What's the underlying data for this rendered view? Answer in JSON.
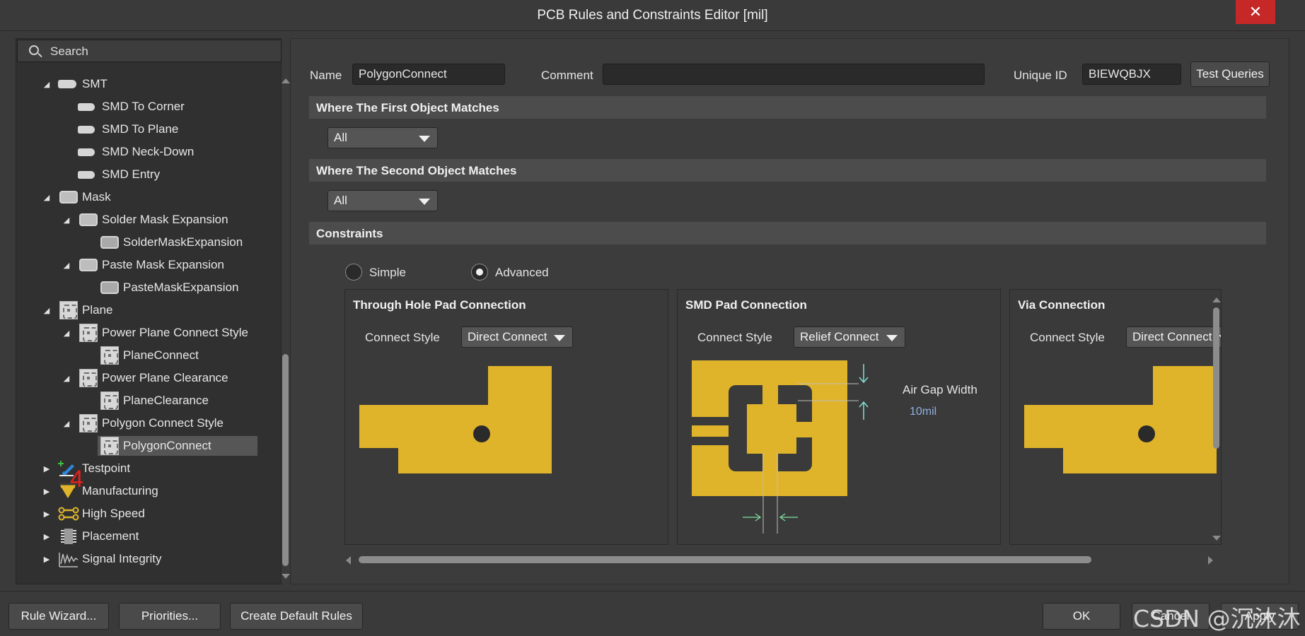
{
  "window": {
    "title": "PCB Rules and Constraints Editor [mil]"
  },
  "search": {
    "placeholder": "Search"
  },
  "tree": {
    "smt": "SMT",
    "smd_to_corner": "SMD To Corner",
    "smd_to_plane": "SMD To Plane",
    "smd_neck_down": "SMD Neck-Down",
    "smd_entry": "SMD Entry",
    "mask": "Mask",
    "solder_mask_expansion": "Solder Mask Expansion",
    "solder_mask_expansion_rule": "SolderMaskExpansion",
    "paste_mask_expansion": "Paste Mask Expansion",
    "paste_mask_expansion_rule": "PasteMaskExpansion",
    "plane": "Plane",
    "power_plane_connect_style": "Power Plane Connect Style",
    "plane_connect": "PlaneConnect",
    "power_plane_clearance": "Power Plane Clearance",
    "plane_clearance": "PlaneClearance",
    "polygon_connect_style": "Polygon Connect Style",
    "polygon_connect": "PolygonConnect",
    "testpoint": "Testpoint",
    "manufacturing": "Manufacturing",
    "high_speed": "High Speed",
    "placement": "Placement",
    "signal_integrity": "Signal Integrity"
  },
  "annotation": "4",
  "rule": {
    "name_label": "Name",
    "name": "PolygonConnect",
    "comment_label": "Comment",
    "comment": "",
    "unique_id_label": "Unique ID",
    "unique_id": "BIEWQBJX",
    "test_queries": "Test Queries"
  },
  "first_match": {
    "header": "Where The First Object Matches",
    "value": "All"
  },
  "second_match": {
    "header": "Where The Second Object Matches",
    "value": "All"
  },
  "constraints": {
    "header": "Constraints",
    "simple": "Simple",
    "advanced": "Advanced",
    "selected_mode": "Advanced"
  },
  "through_hole": {
    "title": "Through Hole Pad Connection",
    "style_label": "Connect Style",
    "style": "Direct Connect"
  },
  "smd": {
    "title": "SMD Pad Connection",
    "style_label": "Connect Style",
    "style": "Relief Connect",
    "air_gap_label": "Air Gap Width",
    "air_gap_value": "10mil"
  },
  "via": {
    "title": "Via Connection",
    "style_label": "Connect Style",
    "style": "Direct Connect"
  },
  "buttons": {
    "rule_wizard": "Rule Wizard...",
    "priorities": "Priorities...",
    "create_default": "Create Default Rules",
    "ok": "OK",
    "cancel": "Cancel",
    "apply": "Apply"
  },
  "watermark": "CSDN @沉沐沐",
  "colors": {
    "copper": "#e0b42a",
    "accent_red": "#e8201b",
    "close_red": "#c62828"
  }
}
